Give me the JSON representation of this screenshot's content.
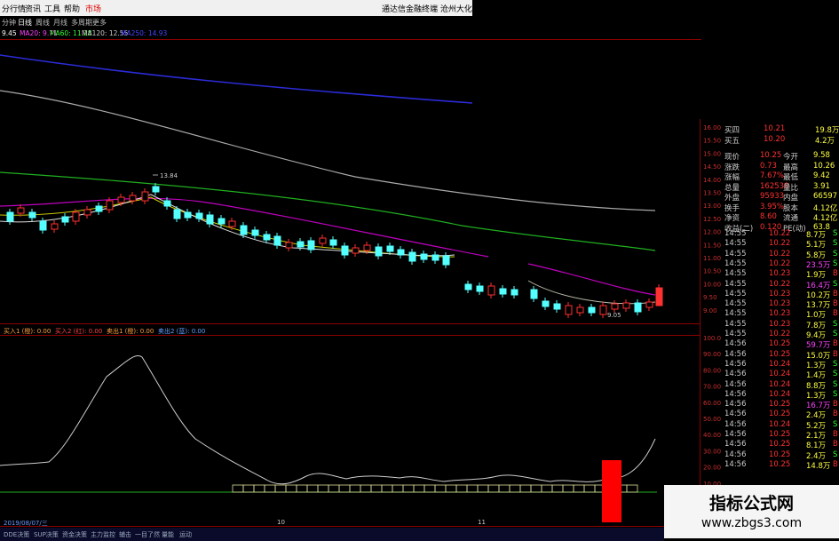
{
  "menu": {
    "items": [
      "分行情",
      "资讯",
      "工具",
      "帮助",
      "市场"
    ],
    "right_text": "通达信金融终端  沧州大化"
  },
  "periods": [
    "分钟",
    "日线",
    "周线",
    "月线",
    "多周期",
    "更多"
  ],
  "ma_bar": [
    "9.45",
    "MA20: 9.71",
    "MA60: 11.28",
    "MA120: 12.55",
    "MA250: 14.93"
  ],
  "price_axis": [
    "16.00",
    "15.50",
    "15.00",
    "14.50",
    "14.00",
    "13.50",
    "13.00",
    "12.50",
    "12.00",
    "11.50",
    "11.00",
    "10.50",
    "10.00",
    "9.50",
    "9.00"
  ],
  "indicator_axis": [
    "100.0",
    "90.00",
    "80.00",
    "70.00",
    "60.00",
    "50.00",
    "40.00",
    "30.00",
    "20.00",
    "10.00",
    "0.00"
  ],
  "annotations": {
    "high": "13.84",
    "low": "9.05"
  },
  "indicator_bar": [
    "买入1 (橙): 0.00",
    "买入2 (红): 0.00",
    "卖出1 (橙): 0.00",
    "卖出2 (蓝): 0.00"
  ],
  "quote": {
    "bid4": {
      "label": "买四",
      "price": "10.21",
      "vol": "19.8万"
    },
    "bid5": {
      "label": "买五",
      "price": "10.20",
      "vol": "4.2万"
    },
    "rows": [
      {
        "l1": "现价",
        "v1": "10.25",
        "l2": "今开",
        "v2": "9.58"
      },
      {
        "l1": "涨跌",
        "v1": "0.73",
        "l2": "最高",
        "v2": "10.26"
      },
      {
        "l1": "涨幅",
        "v1": "7.67%",
        "l2": "最低",
        "v2": "9.42"
      },
      {
        "l1": "总量",
        "v1": "162538",
        "l2": "量比",
        "v2": "3.91"
      },
      {
        "l1": "外盘",
        "v1": "95933",
        "l2": "内盘",
        "v2": "66597"
      },
      {
        "l1": "换手",
        "v1": "3.95%",
        "l2": "股本",
        "v2": "4.12亿"
      },
      {
        "l1": "净资",
        "v1": "8.60",
        "l2": "流通",
        "v2": "4.12亿"
      },
      {
        "l1": "收益(二)",
        "v1": "0.120",
        "l2": "PE(动)",
        "v2": "63.8"
      }
    ]
  },
  "ticks": [
    [
      "14:55",
      "10.22",
      "8.7万",
      "S"
    ],
    [
      "14:55",
      "10.22",
      "5.1万",
      "S"
    ],
    [
      "14:55",
      "10.22",
      "5.8万",
      "S"
    ],
    [
      "14:55",
      "10.22",
      "23.5万",
      "S"
    ],
    [
      "14:55",
      "10.23",
      "1.9万",
      "B"
    ],
    [
      "14:55",
      "10.22",
      "16.4万",
      "S"
    ],
    [
      "14:55",
      "10.23",
      "10.2万",
      "B"
    ],
    [
      "14:55",
      "10.23",
      "13.7万",
      "B"
    ],
    [
      "14:55",
      "10.23",
      "1.0万",
      "B"
    ],
    [
      "14:55",
      "10.23",
      "7.8万",
      "S"
    ],
    [
      "14:55",
      "10.22",
      "9.4万",
      "S"
    ],
    [
      "14:56",
      "10.25",
      "59.7万",
      "B"
    ],
    [
      "14:56",
      "10.25",
      "15.0万",
      "B"
    ],
    [
      "14:56",
      "10.24",
      "1.3万",
      "S"
    ],
    [
      "14:56",
      "10.24",
      "1.4万",
      "S"
    ],
    [
      "14:56",
      "10.24",
      "8.8万",
      "S"
    ],
    [
      "14:56",
      "10.24",
      "1.3万",
      "S"
    ],
    [
      "14:56",
      "10.25",
      "16.7万",
      "B"
    ],
    [
      "14:56",
      "10.25",
      "2.4万",
      "B"
    ],
    [
      "14:56",
      "10.24",
      "5.2万",
      "S"
    ],
    [
      "14:56",
      "10.25",
      "2.1万",
      "B"
    ],
    [
      "14:56",
      "10.25",
      "8.1万",
      "B"
    ],
    [
      "14:56",
      "10.25",
      "2.4万",
      "S"
    ],
    [
      "14:56",
      "10.25",
      "14.8万",
      "B"
    ]
  ],
  "watermark": {
    "title": "指标公式网",
    "url": "www.zbgs3.com"
  },
  "bottom": {
    "date": "2019/08/07/三",
    "axis_labels": [
      "10",
      "11"
    ],
    "tabs": [
      "DDE决策",
      "SUP决策",
      "资金决策",
      "主力监控",
      "辅击",
      "一目了然",
      "量能",
      "运动"
    ]
  },
  "colors": {
    "up": "#ff3030",
    "down": "#54ffff",
    "ma5": "#dddddd",
    "ma10": "#ffff00",
    "ma20": "#ff00ff",
    "ma60": "#00cc00",
    "ma120": "#3333ff",
    "ma250": "#888888"
  }
}
